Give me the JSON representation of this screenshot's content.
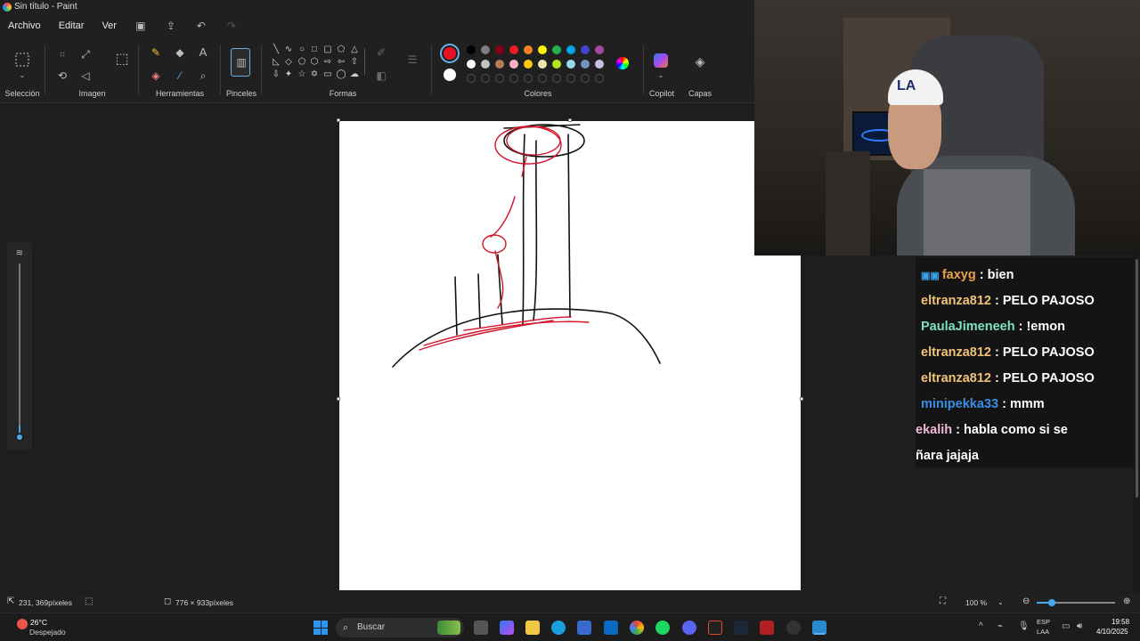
{
  "window": {
    "title": "Sin título - Paint"
  },
  "menu": {
    "file": "Archivo",
    "edit": "Editar",
    "view": "Ver"
  },
  "ribbon": {
    "groups": {
      "selection": "Selección",
      "image": "Imagen",
      "tools": "Herramientas",
      "brushes": "Pinceles",
      "shapes": "Formas",
      "colors": "Colores",
      "copilot": "Copilot",
      "layers": "Capas"
    },
    "accent": "#e81123"
  },
  "palette": {
    "row1": [
      "#000000",
      "#7f7f7f",
      "#880015",
      "#ed1c24",
      "#ff7f27",
      "#fff200",
      "#22b14c",
      "#00a2e8",
      "#3f48cc",
      "#a349a4"
    ],
    "row2": [
      "#ffffff",
      "#c3c3c3",
      "#b97a57",
      "#ffaec9",
      "#ffc90e",
      "#efe4b0",
      "#b5e61d",
      "#99d9ea",
      "#7092be",
      "#c8bfe7"
    ],
    "primary": "#e81123",
    "secondary": "#ffffff"
  },
  "status": {
    "cursor": "231, 369píxeles",
    "canvas_size": "776 × 933píxeles",
    "zoom": "100 %"
  },
  "taskbar": {
    "weather_temp": "26°C",
    "weather_desc": "Despejado",
    "search_placeholder": "Buscar",
    "lang_top": "ESP",
    "lang_bottom": "LAA",
    "time": "19:58",
    "date": "4/10/2025"
  },
  "chat": {
    "messages": [
      {
        "user": "faxyg",
        "text": " : bien",
        "color": "#e8a24a"
      },
      {
        "user": "eltranza812",
        "text": " : PELO PAJOSO",
        "color": "#f0c27a"
      },
      {
        "user": "PaulaJimeneeh",
        "text": " : !emon",
        "color": "#7fe0c4"
      },
      {
        "user": "eltranza812",
        "text": " : PELO PAJOSO",
        "color": "#f0c27a"
      },
      {
        "user": "eltranza812",
        "text": " : PELO PAJOSO",
        "color": "#f0c27a"
      },
      {
        "user": "minipekka33",
        "text": " : mmm",
        "color": "#3a8ee6"
      },
      {
        "user": "ekalih",
        "text": " : habla como si se",
        "color": "#f0b8d8"
      },
      {
        "user": "",
        "text": "ñara jajaja",
        "color": "#ffffff"
      }
    ]
  },
  "webcam": {
    "cap_logo": "LA"
  }
}
